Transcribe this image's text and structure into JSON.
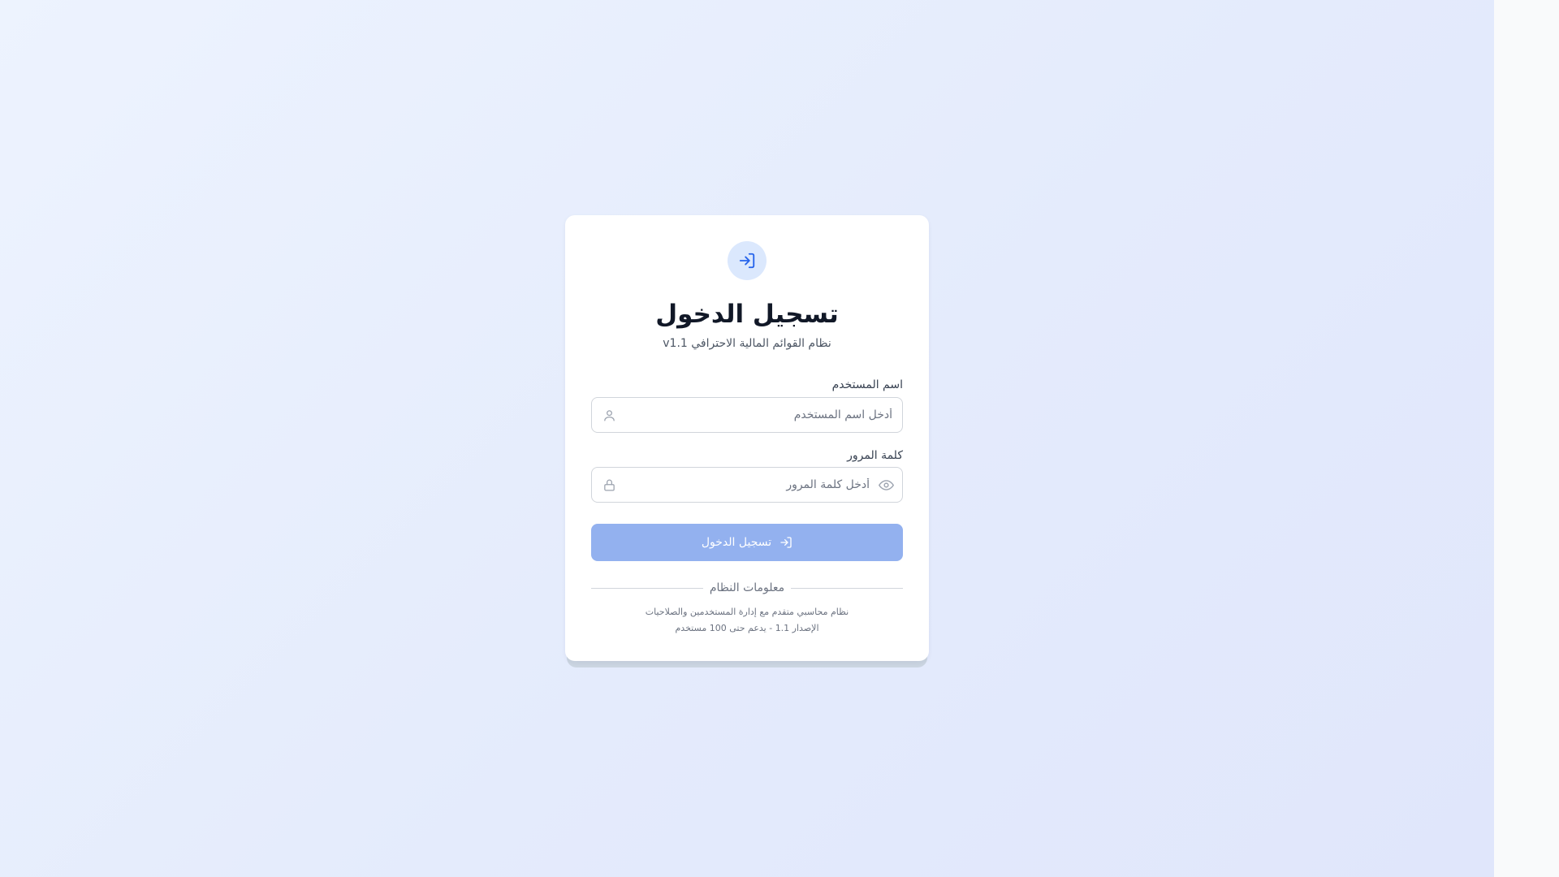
{
  "login": {
    "title": "تسجيل الدخول",
    "subtitle": "نظام القوائم المالية الاحترافي v1.1",
    "username_label": "اسم المستخدم",
    "username_placeholder": "أدخل اسم المستخدم",
    "username_value": "",
    "password_label": "كلمة المرور",
    "password_placeholder": "أدخل كلمة المرور",
    "password_value": "",
    "submit_label": "تسجيل الدخول",
    "submit_icon": "login-icon",
    "logo_icon": "login-icon"
  },
  "system_info": {
    "heading": "معلومات النظام",
    "line1": "نظام محاسبي متقدم مع إدارة المستخدمين والصلاحيات",
    "line2": "الإصدار 1.1 - يدعم حتى 100 مستخدم"
  },
  "icons": {
    "username": "user-icon",
    "password": "lock-icon",
    "toggle_password": "eye-icon"
  },
  "colors": {
    "accent": "#2563eb",
    "button_disabled": "#93b1ef",
    "logo_bg": "#dbe8fd",
    "title": "#111827"
  }
}
